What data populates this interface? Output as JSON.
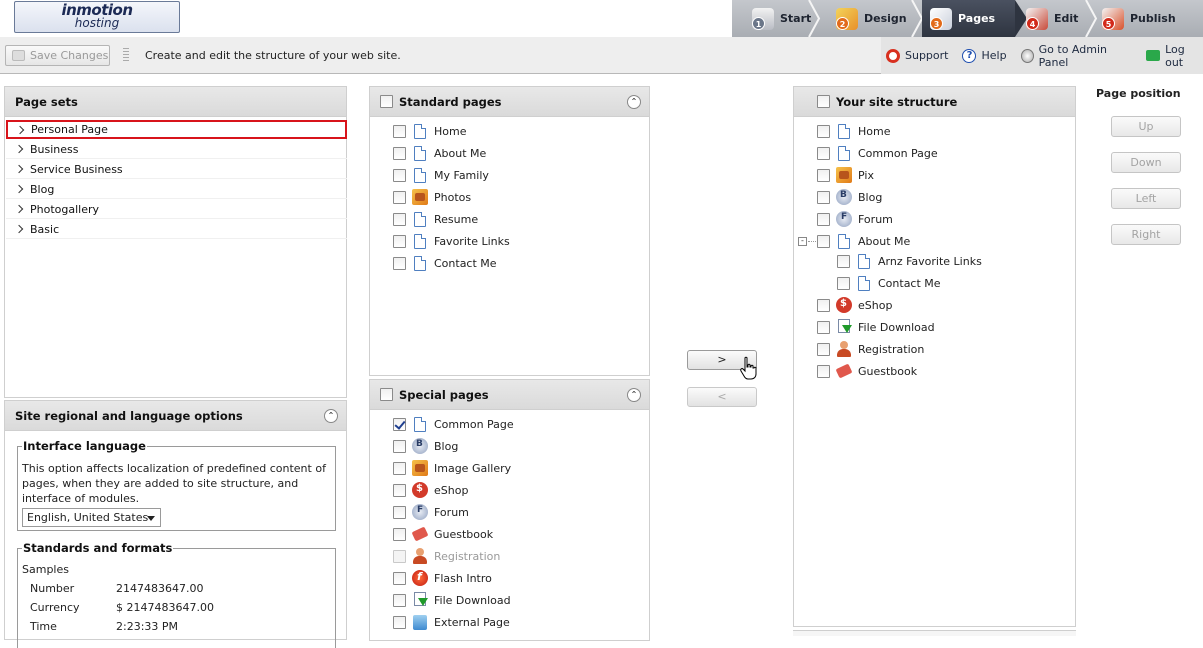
{
  "brand": {
    "line1": "inmotion",
    "line2": "hosting"
  },
  "steps": [
    {
      "num": "1",
      "label": "Start",
      "color": "#6b7689"
    },
    {
      "num": "2",
      "label": "Design",
      "color": "#e26a1a"
    },
    {
      "num": "3",
      "label": "Pages",
      "color": "#e26a1a",
      "active": true
    },
    {
      "num": "4",
      "label": "Edit",
      "color": "#d22a1a"
    },
    {
      "num": "5",
      "label": "Publish",
      "color": "#d22a1a"
    }
  ],
  "toolbar": {
    "save_label": "Save Changes",
    "description": "Create and edit the structure of your web site.",
    "support": "Support",
    "help": "Help",
    "admin": "Go to Admin Panel",
    "logout": "Log out"
  },
  "page_sets": {
    "title": "Page sets",
    "items": [
      "Personal Page",
      "Business",
      "Service Business",
      "Blog",
      "Photogallery",
      "Basic"
    ],
    "selected": "Personal Page"
  },
  "regional": {
    "title": "Site regional and language options",
    "interface_legend": "Interface language",
    "interface_desc": "This option affects localization of predefined content of pages, when they are added to site structure, and interface of modules.",
    "language_value": "English, United States",
    "standards_legend": "Standards and formats",
    "samples_label": "Samples",
    "samples": [
      {
        "label": "Number",
        "value": "2147483647.00"
      },
      {
        "label": "Currency",
        "value": "$ 2147483647.00"
      },
      {
        "label": "Time",
        "value": "2:23:33 PM"
      }
    ]
  },
  "standard_pages": {
    "title": "Standard pages",
    "items": [
      {
        "label": "Home",
        "icon": "page-icon"
      },
      {
        "label": "About Me",
        "icon": "page-icon"
      },
      {
        "label": "My Family",
        "icon": "page-icon"
      },
      {
        "label": "Photos",
        "icon": "photo-icon"
      },
      {
        "label": "Resume",
        "icon": "page-icon"
      },
      {
        "label": "Favorite Links",
        "icon": "page-icon"
      },
      {
        "label": "Contact Me",
        "icon": "page-icon"
      }
    ]
  },
  "special_pages": {
    "title": "Special pages",
    "items": [
      {
        "label": "Common Page",
        "icon": "page-icon",
        "checked": true
      },
      {
        "label": "Blog",
        "icon": "blog-icon"
      },
      {
        "label": "Image Gallery",
        "icon": "photo-icon"
      },
      {
        "label": "eShop",
        "icon": "shop-icon"
      },
      {
        "label": "Forum",
        "icon": "forum-icon"
      },
      {
        "label": "Guestbook",
        "icon": "guestbook-icon"
      },
      {
        "label": "Registration",
        "icon": "registration-icon",
        "disabled": true
      },
      {
        "label": "Flash Intro",
        "icon": "flash-icon"
      },
      {
        "label": "File Download",
        "icon": "download-icon"
      },
      {
        "label": "External Page",
        "icon": "external-icon"
      }
    ]
  },
  "transfer": {
    "add_label": ">",
    "remove_label": "<"
  },
  "site_structure": {
    "title": "Your site structure",
    "items": [
      {
        "label": "Home",
        "icon": "page-icon",
        "level": 0
      },
      {
        "label": "Common Page",
        "icon": "page-icon",
        "level": 0
      },
      {
        "label": "Pix",
        "icon": "photo-icon",
        "level": 0
      },
      {
        "label": "Blog",
        "icon": "blog-icon",
        "level": 0
      },
      {
        "label": "Forum",
        "icon": "forum-icon",
        "level": 0
      },
      {
        "label": "About Me",
        "icon": "page-icon",
        "level": 0,
        "expanded": true
      },
      {
        "label": "Arnz Favorite Links",
        "icon": "page-icon",
        "level": 1
      },
      {
        "label": "Contact Me",
        "icon": "page-icon",
        "level": 1
      },
      {
        "label": "eShop",
        "icon": "shop-icon",
        "level": 0
      },
      {
        "label": "File Download",
        "icon": "download-icon",
        "level": 0
      },
      {
        "label": "Registration",
        "icon": "registration-icon",
        "level": 0
      },
      {
        "label": "Guestbook",
        "icon": "guestbook-icon",
        "level": 0
      }
    ]
  },
  "page_position": {
    "title": "Page position",
    "buttons": [
      "Up",
      "Down",
      "Left",
      "Right"
    ]
  }
}
